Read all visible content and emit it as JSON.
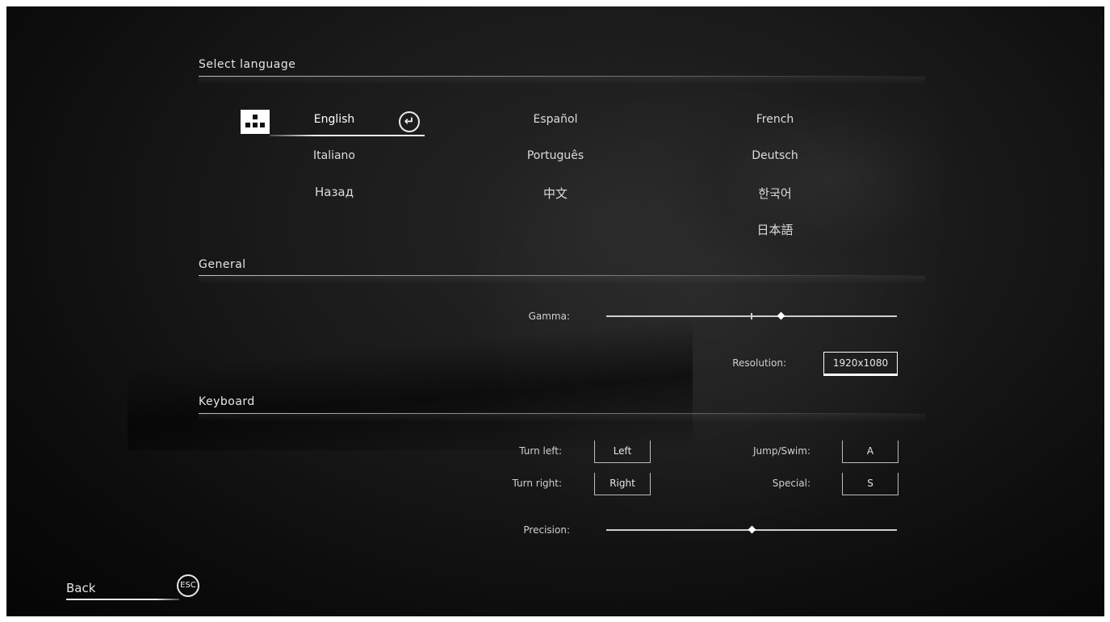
{
  "sections": {
    "language": "Select language",
    "general": "General",
    "keyboard": "Keyboard"
  },
  "languages": [
    {
      "label": "English",
      "selected": true
    },
    {
      "label": "Español"
    },
    {
      "label": "French"
    },
    {
      "label": "Italiano"
    },
    {
      "label": "Português"
    },
    {
      "label": "Deutsch"
    },
    {
      "label": "Назад"
    },
    {
      "label": "中文"
    },
    {
      "label": "한국어"
    },
    {
      "label": "日本語"
    }
  ],
  "general": {
    "gamma_label": "Gamma:",
    "gamma_level": 0.6,
    "resolution_label": "Resolution:",
    "resolution_value": "1920x1080"
  },
  "keyboard": {
    "turn_left_label": "Turn left:",
    "turn_left_value": "Left",
    "turn_right_label": "Turn right:",
    "turn_right_value": "Right",
    "jump_label": "Jump/Swim:",
    "jump_value": "A",
    "special_label": "Special:",
    "special_value": "S",
    "precision_label": "Precision:",
    "precision_level": 0.5
  },
  "footer": {
    "back_label": "Back",
    "esc_label": "ESC"
  }
}
